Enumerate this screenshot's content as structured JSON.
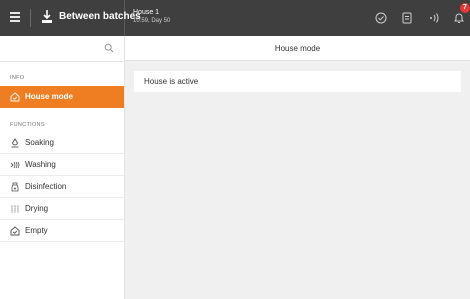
{
  "topbar": {
    "menu_icon": "hamburger-icon",
    "mode_icon": "water-drop-icon",
    "mode_label": "Between batches",
    "house_name": "House 1",
    "house_time": "10:59, Day 50",
    "icons": [
      "checkmark-circle-icon",
      "document-icon",
      "signal-icon",
      "bell-icon"
    ],
    "notification_count": "7"
  },
  "sidebar": {
    "search_icon": "search-icon",
    "info_label": "INFO",
    "info_items": [
      {
        "label": "House mode",
        "icon": "house-check-icon",
        "active": true
      }
    ],
    "functions_label": "FUNCTIONS",
    "function_items": [
      {
        "label": "Soaking",
        "icon": "soaking-icon"
      },
      {
        "label": "Washing",
        "icon": "washing-icon"
      },
      {
        "label": "Disinfection",
        "icon": "disinfection-icon"
      },
      {
        "label": "Drying",
        "icon": "drying-icon"
      },
      {
        "label": "Empty",
        "icon": "empty-icon"
      }
    ]
  },
  "main": {
    "title": "House mode",
    "status": "House is active"
  },
  "colors": {
    "topbar": "#3f3f3f",
    "accent": "#ef7d22",
    "badge": "#e53935",
    "content_bg": "#f0f0f0"
  }
}
